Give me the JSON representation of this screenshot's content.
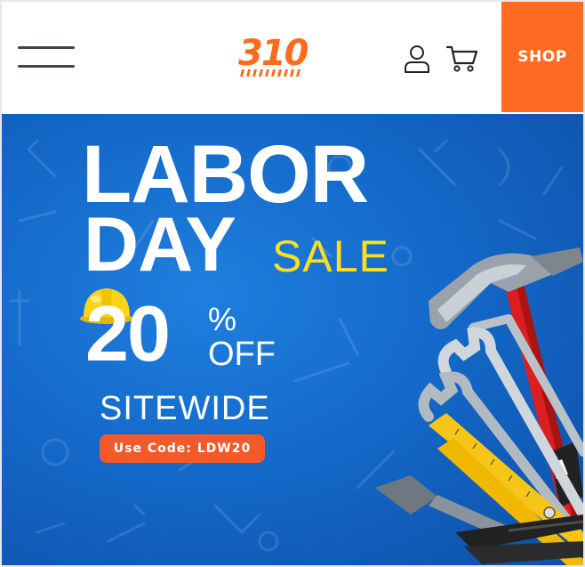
{
  "header": {
    "logo_text": "310",
    "shop_label": "SHOP",
    "icons": {
      "menu": "hamburger-menu-icon",
      "account": "user-icon",
      "cart": "cart-icon"
    }
  },
  "banner": {
    "headline_line1": "LABOR",
    "headline_line2": "DAY",
    "sale_word": "SALE",
    "discount_number": "20",
    "percent_sign": "%",
    "off_word": "OFF",
    "scope": "SITEWIDE",
    "code_label": "Use Code: LDW20"
  },
  "colors": {
    "brand_orange": "#ff6b22",
    "banner_blue": "#1469c9",
    "sale_yellow": "#ffdd1f",
    "code_badge": "#f25a2a"
  }
}
